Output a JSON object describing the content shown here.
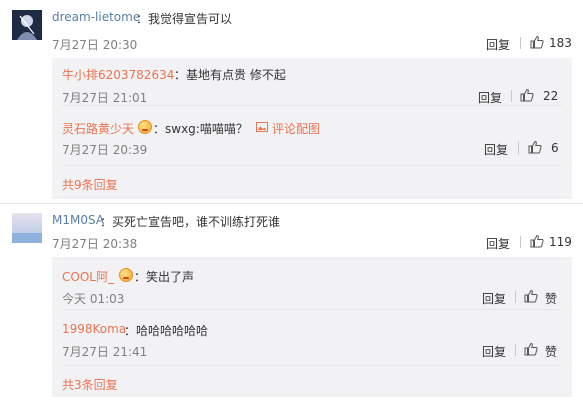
{
  "comments": [
    {
      "user": "dream-lietome",
      "text": "：我觉得宣告可以",
      "time": "7月27日 20:30",
      "reply_label": "回复",
      "likes": "183",
      "replies": [
        {
          "user": "牛小排6203782634",
          "text": "：基地有点贵 修不起",
          "time": "7月27日 21:01",
          "reply_label": "回复",
          "likes": "22"
        },
        {
          "user": "灵石路黄少天",
          "text": "：swxg:喵喵喵？",
          "image_link": "评论配图",
          "time": "7月27日 20:39",
          "reply_label": "回复",
          "likes": "6"
        }
      ],
      "more_replies": "共9条回复"
    },
    {
      "user": "M1M0SA",
      "text": "：买死亡宣告吧，谁不训练打死谁",
      "time": "7月27日 20:38",
      "reply_label": "回复",
      "likes": "119",
      "replies": [
        {
          "user": "COOL阿_",
          "text": "：笑出了声",
          "time": "今天 01:03",
          "reply_label": "回复",
          "likes": "赞"
        },
        {
          "user": "1998Koma",
          "text": "：哈哈哈哈哈哈",
          "time": "7月27日 21:41",
          "reply_label": "回复",
          "likes": "赞"
        }
      ],
      "more_replies": "共3条回复"
    }
  ]
}
